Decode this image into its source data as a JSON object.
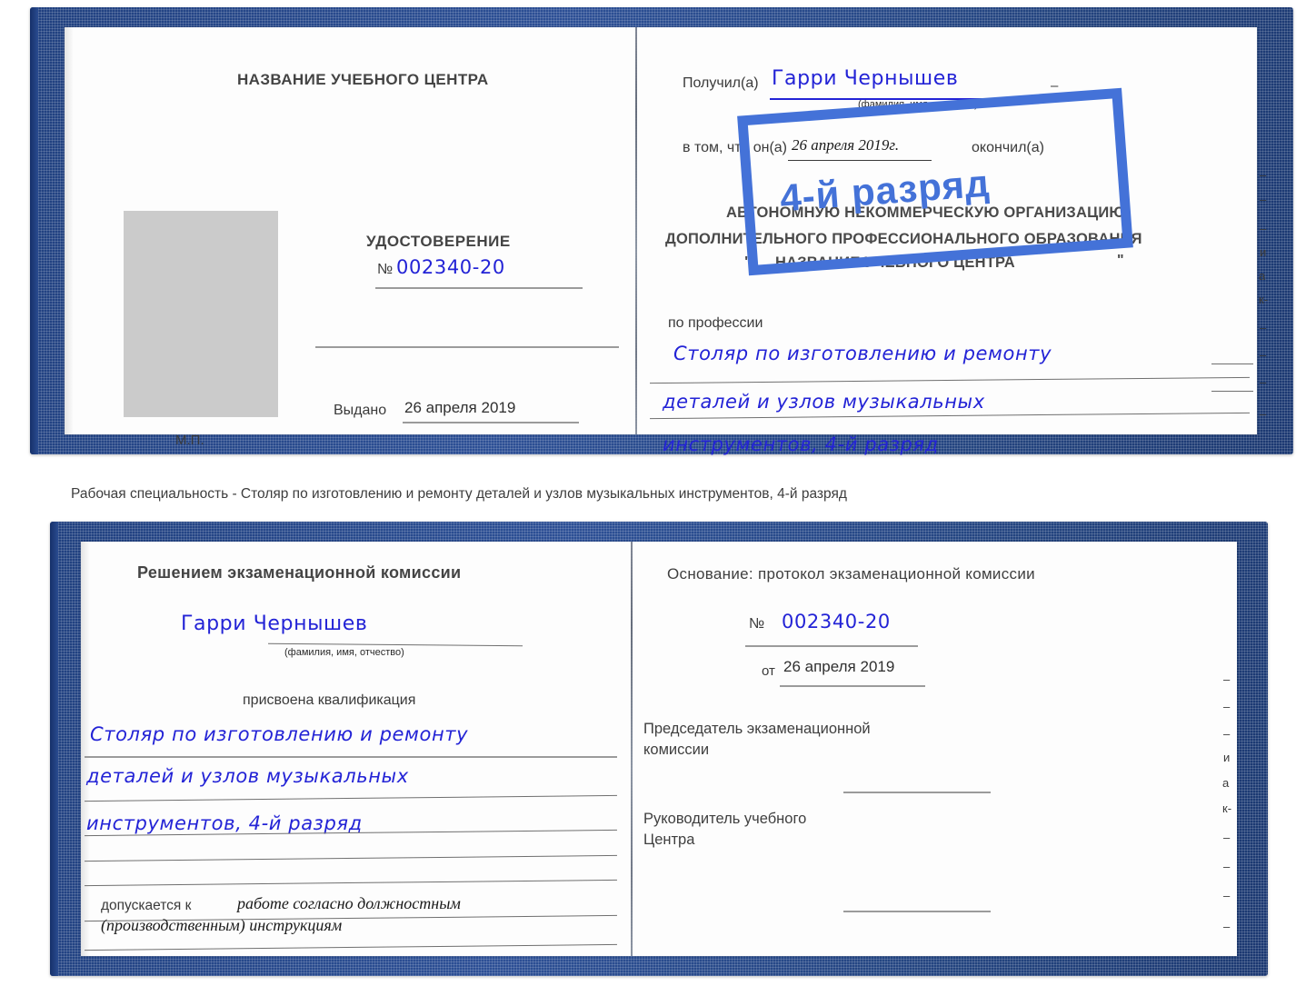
{
  "caption": "Рабочая специальность - Столяр по изготовлению и ремонту деталей и узлов музыкальных инструментов, 4-й разряд",
  "certificate_top": {
    "left_page": {
      "center_name": "НАЗВАНИЕ УЧЕБНОГО ЦЕНТРА",
      "doc_title": "УДОСТОВЕРЕНИЕ",
      "number_symbol": "№",
      "number_value": "002340-20",
      "issued_label": "Выдано",
      "issued_value": "26 апреля 2019",
      "seal_label": "М.П."
    },
    "right_page": {
      "received_label": "Получил(а)",
      "received_value": "Гарри Чернышев",
      "fio_hint": "(фамилия, имя, отчество)",
      "that_he_label": "в том, что он(а)",
      "date_value": "26 апреля 2019г.",
      "finished_label": "окончил(а)",
      "org_line1": "АВТОНОМНУЮ НЕКОММЕРЧЕСКУЮ ОРГАНИЗАЦИЮ",
      "org_line2": "ДОПОЛНИТЕЛЬНОГО ПРОФЕССИОНАЛЬНОГО ОБРАЗОВАНИЯ",
      "org_quote_open": "\"",
      "org_line3": "НАЗВАНИЕ УЧЕБНОГО ЦЕНТРА",
      "org_quote_close": "\"",
      "profession_label": "по профессии",
      "profession_line1": "Столяр по изготовлению и ремонту",
      "profession_line2": "деталей и узлов музыкальных",
      "profession_line3": "инструментов, 4-й разряд"
    },
    "stamp": {
      "text": "4-й разряд",
      "color": "#4472d8"
    },
    "edge_fragments": [
      "–",
      "–",
      "–",
      "и",
      "а",
      "к-",
      "–",
      "–",
      "–",
      "–"
    ]
  },
  "certificate_bottom": {
    "left_page": {
      "decision_title": "Решением экзаменационной комиссии",
      "name_value": "Гарри Чернышев",
      "fio_hint": "(фамилия, имя, отчество)",
      "qualification_label": "присвоена квалификация",
      "qual_line1": "Столяр по изготовлению и ремонту",
      "qual_line2": "деталей и узлов музыкальных",
      "qual_line3": "инструментов, 4-й разряд",
      "admitted_label": "допускается к",
      "admitted_value_line1": "работе согласно должностным",
      "admitted_value_line2": "(производственным) инструкциям"
    },
    "right_page": {
      "basis_label": "Основание: протокол экзаменационной комиссии",
      "number_symbol": "№",
      "number_value": "002340-20",
      "from_label": "от",
      "from_value": "26 апреля 2019",
      "chairman_line1": "Председатель экзаменационной",
      "chairman_line2": "комиссии",
      "head_line1": "Руководитель учебного",
      "head_line2": "Центра"
    },
    "edge_fragments": [
      "–",
      "–",
      "–",
      "и",
      "а",
      "к-",
      "–",
      "–",
      "–",
      "–"
    ]
  },
  "colors": {
    "cover_blue": "#24457f",
    "ink_blue": "#2323d6",
    "stamp_blue": "#4472d8",
    "photo_gray": "#cbcbcb",
    "text_gray": "#3a3a3a"
  }
}
